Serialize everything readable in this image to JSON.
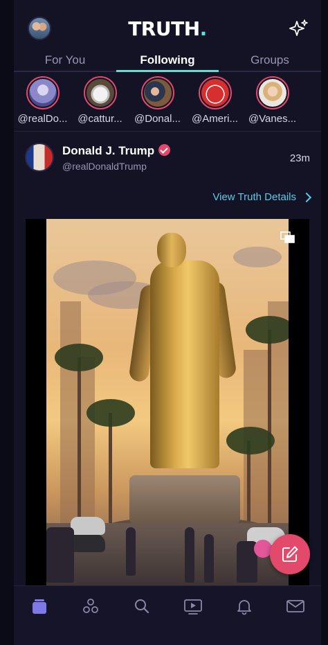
{
  "header": {
    "logo_text": "TRUTH",
    "logo_dot": ".",
    "avatar_icon": "user-avatar",
    "sparkle_icon": "sparkle-icon"
  },
  "tabs": [
    {
      "label": "For You",
      "active": false
    },
    {
      "label": "Following",
      "active": true
    },
    {
      "label": "Groups",
      "active": false
    }
  ],
  "stories": [
    {
      "label": "@realDo..."
    },
    {
      "label": "@cattur..."
    },
    {
      "label": "@Donal..."
    },
    {
      "label": "@Ameri..."
    },
    {
      "label": "@Vanes..."
    }
  ],
  "post": {
    "author_name": "Donald J. Trump",
    "handle": "@realDonaldTrump",
    "time": "23m",
    "view_details_label": "View Truth Details",
    "verified_color": "#e2496a"
  },
  "colors": {
    "accent_teal": "#5ce0d8",
    "link_blue": "#5ccbe6",
    "brand_pink": "#e2496a",
    "background": "#141225"
  },
  "bottom_nav": [
    {
      "icon": "home-icon",
      "active": true
    },
    {
      "icon": "groups-icon",
      "active": false
    },
    {
      "icon": "search-icon",
      "active": false
    },
    {
      "icon": "video-icon",
      "active": false
    },
    {
      "icon": "bell-icon",
      "active": false
    },
    {
      "icon": "mail-icon",
      "active": false
    }
  ]
}
